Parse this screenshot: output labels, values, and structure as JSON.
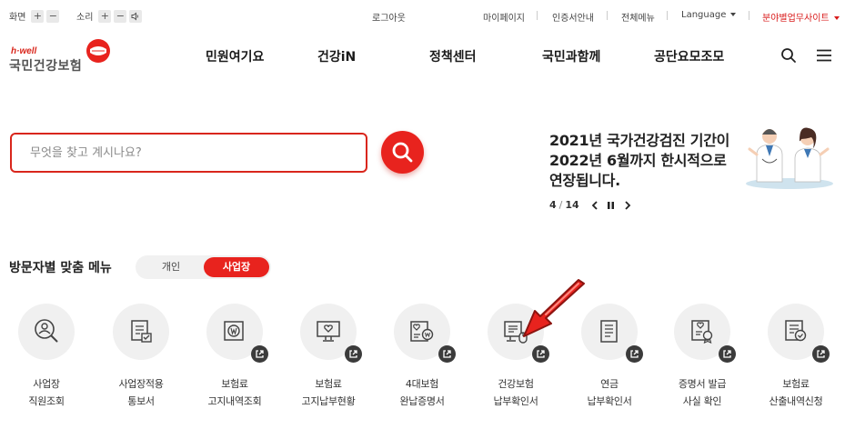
{
  "util": {
    "screen_label": "화면",
    "sound_label": "소리",
    "plus": "+",
    "minus": "−",
    "logout": "로그아웃",
    "mypage": "마이페이지",
    "cert_guide": "인증서안내",
    "all_menu": "전체메뉴",
    "language": "Language",
    "field_site": "분야별업무사이트"
  },
  "logo": {
    "hwell": "h·well",
    "name": "국민건강보험"
  },
  "nav": [
    "민원여기요",
    "건강iN",
    "정책센터",
    "국민과함께",
    "공단요모조모"
  ],
  "search": {
    "placeholder": "무엇을 찾고 계시나요?"
  },
  "notice": {
    "lines": [
      "2021년 국가건강검진 기간이",
      "2022년 6월까지 한시적으로",
      "연장됩니다."
    ],
    "current": "4",
    "separator": "/",
    "total": "14"
  },
  "visitor": {
    "title": "방문자별 맞춤 메뉴",
    "tabs": [
      "개인",
      "사업장"
    ],
    "active_tab": "사업장"
  },
  "menu_items": [
    {
      "icon": "user-search-icon",
      "line1": "사업장",
      "line2": "직원조회",
      "external": false
    },
    {
      "icon": "document-check-icon",
      "line1": "사업장적용",
      "line2": "통보서",
      "external": false
    },
    {
      "icon": "won-document-icon",
      "line1": "보험료",
      "line2": "고지내역조회",
      "external": true
    },
    {
      "icon": "monitor-heart-icon",
      "line1": "보험료",
      "line2": "고지납부현황",
      "external": true
    },
    {
      "icon": "heart-won-card-icon",
      "line1": "4대보험",
      "line2": "완납증명서",
      "external": true
    },
    {
      "icon": "monitor-mouse-icon",
      "line1": "건강보험",
      "line2": "납부확인서",
      "external": true
    },
    {
      "icon": "document-list-icon",
      "line1": "연금",
      "line2": "납부확인서",
      "external": true
    },
    {
      "icon": "certificate-ribbon-icon",
      "line1": "증명서 발급",
      "line2": "사실 확인",
      "external": true
    },
    {
      "icon": "document-verify-icon",
      "line1": "보험료",
      "line2": "산출내역신청",
      "external": true
    }
  ],
  "colors": {
    "brand_red": "#e8231e",
    "toggle_bg": "#f1f1f1",
    "icon_circle": "#f0f0f0",
    "text": "#222222"
  }
}
